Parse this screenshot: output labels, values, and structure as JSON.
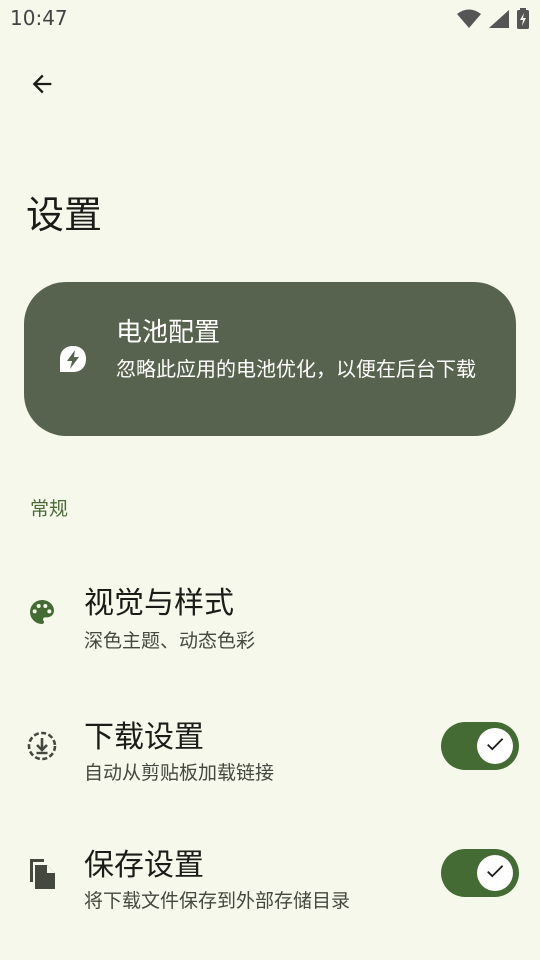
{
  "status_bar": {
    "time": "10:47",
    "icons": [
      "wifi-icon",
      "signal-icon",
      "battery-charging-icon"
    ]
  },
  "header": {
    "back_icon": "arrow-back-icon",
    "title": "设置"
  },
  "battery_card": {
    "icon": "battery-saver-leaf-icon",
    "title": "电池配置",
    "description": "忽略此应用的电池优化，以便在后台下载",
    "background_color": "#58634f"
  },
  "sections": {
    "general_header": "常规"
  },
  "settings": [
    {
      "icon": "palette-icon",
      "title": "视觉与样式",
      "subtitle": "深色主题、动态色彩"
    },
    {
      "icon": "download-circle-icon",
      "title": "下载设置",
      "subtitle": "自动从剪贴板加载链接",
      "toggle": true
    },
    {
      "icon": "file-copy-icon",
      "title": "保存设置",
      "subtitle": "将下载文件保存到外部存储目录",
      "toggle": true
    }
  ],
  "colors": {
    "accent": "#456b34",
    "background": "#f6f8ec",
    "section_header": "#4a6b38"
  }
}
